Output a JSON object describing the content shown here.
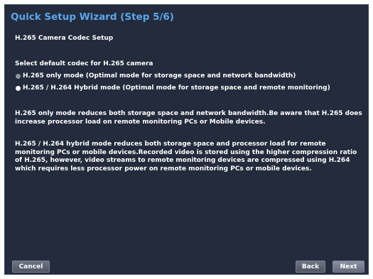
{
  "wizard": {
    "title": "Quick Setup Wizard (Step 5/6)",
    "subtitle": "H.265 Camera Codec Setup",
    "prompt": "Select default codec for H.265 camera",
    "options": [
      {
        "label": "H.265 only mode (Optimal mode for storage space and network bandwidth)",
        "selected": false
      },
      {
        "label": "H.265 / H.264 Hybrid mode (Optimal mode for storage space and remote monitoring)",
        "selected": true
      }
    ],
    "paragraphs": [
      "H.265 only mode reduces both storage space and network bandwidth.Be aware that H.265 does increase processor load on remote monitoring PCs or Mobile devices.",
      "H.265 / H.264 hybrid mode reduces both storage space and processor load for remote monitoring PCs or mobile devices.Recorded video is stored using the higher compression ratio of H.265, however, video streams to remote monitoring devices are compressed using H.264 which requires less processor power on remote monitoring PCs or mobile devices."
    ],
    "buttons": {
      "cancel": "Cancel",
      "back": "Back",
      "next": "Next"
    }
  },
  "colors": {
    "panel_background": "#232b3c",
    "title_accent": "#5aa7ec",
    "text": "#ffffff"
  }
}
